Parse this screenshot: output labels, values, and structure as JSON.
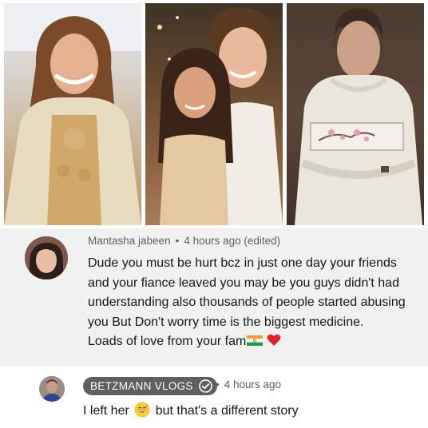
{
  "photos": [
    {
      "alt": "woman in embroidered outfit"
    },
    {
      "alt": "couple posing together"
    },
    {
      "alt": "man in white hoodie"
    }
  ],
  "comment": {
    "author": "Mantasha jabeen",
    "separator": "•",
    "time": "4 hours ago (edited)",
    "text_main": "Dude you must be hurt bcz in just one day your friends and your fiance leaved you may be you guys didn't had understanding also thousands of people started abusing you  But Don't worry time is the biggest  medicine.",
    "text_line2": "Loads of love from your fam",
    "emojis": [
      "india-flag-icon",
      "red-heart-icon"
    ]
  },
  "reply": {
    "channel": "BETZMANN VLOGS",
    "verified": true,
    "separator": "•",
    "time": "4 hours ago",
    "text_before": "I left her",
    "text_after": "but that's a different story",
    "emoji": "grinning-sweat-emoji-icon"
  },
  "colors": {
    "card_bg": "#f1f1f1",
    "badge_bg": "#5f5f5f",
    "meta_text": "#606060",
    "body_text": "#161616"
  }
}
